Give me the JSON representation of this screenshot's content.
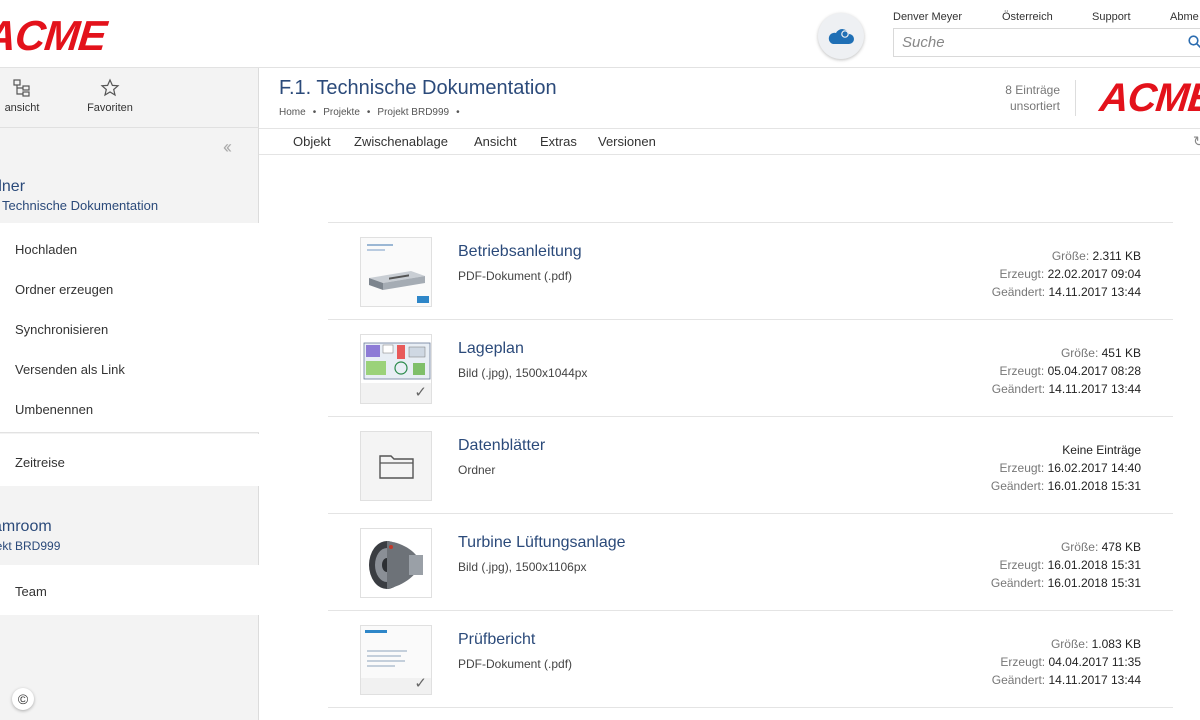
{
  "brand": {
    "logo": "ACME",
    "accent": "#e3121b",
    "link_color": "#2b4a7a"
  },
  "topbar": {
    "user": "Denver Meyer",
    "country": "Österreich",
    "support": "Support",
    "logout": "Abme",
    "search_placeholder": "Suche"
  },
  "sidebar": {
    "tabs": [
      {
        "label": "ansicht",
        "icon": "tree-view-icon"
      },
      {
        "label": "Favoriten",
        "icon": "star-icon"
      }
    ],
    "folder_section": {
      "title": "dner",
      "subtitle": "Technische Dokumentation"
    },
    "actions": [
      "Hochladen",
      "Ordner erzeugen",
      "Synchronisieren",
      "Versenden als Link",
      "Umbenennen"
    ],
    "timetravel": "Zeitreise",
    "teamroom_section": {
      "title": "amroom",
      "subtitle": "jekt BRD999"
    },
    "team": "Team",
    "copyright": "©"
  },
  "header": {
    "title": "F.1. Technische Dokumentation",
    "breadcrumb": [
      "Home",
      "Projekte",
      "Projekt BRD999"
    ],
    "breadcrumb_sep": "•",
    "entries_count": "8 Einträge",
    "entries_sort": "unsortiert",
    "logo": "ACME"
  },
  "menu": [
    "Objekt",
    "Zwischenablage",
    "Ansicht",
    "Extras",
    "Versionen"
  ],
  "files": [
    {
      "name": "Betriebsanleitung",
      "type": "PDF-Dokument (.pdf)",
      "meta": [
        {
          "k": "Größe:",
          "v": "2.311 KB"
        },
        {
          "k": "Erzeugt:",
          "v": "22.02.2017 09:04"
        },
        {
          "k": "Geändert:",
          "v": "14.11.2017 13:44"
        }
      ],
      "thumb": "pdf-server",
      "checked": false
    },
    {
      "name": "Lageplan",
      "type": "Bild (.jpg), 1500x1044px",
      "meta": [
        {
          "k": "Größe:",
          "v": "451 KB"
        },
        {
          "k": "Erzeugt:",
          "v": "05.04.2017 08:28"
        },
        {
          "k": "Geändert:",
          "v": "14.11.2017 13:44"
        }
      ],
      "thumb": "floorplan",
      "checked": true
    },
    {
      "name": "Datenblätter",
      "type": "Ordner",
      "meta": [
        {
          "k": "",
          "v": "Keine Einträge"
        },
        {
          "k": "Erzeugt:",
          "v": "16.02.2017 14:40"
        },
        {
          "k": "Geändert:",
          "v": "16.01.2018 15:31"
        }
      ],
      "thumb": "folder",
      "checked": false
    },
    {
      "name": "Turbine Lüftungsanlage",
      "type": "Bild (.jpg), 1500x1106px",
      "meta": [
        {
          "k": "Größe:",
          "v": "478 KB"
        },
        {
          "k": "Erzeugt:",
          "v": "16.01.2018 15:31"
        },
        {
          "k": "Geändert:",
          "v": "16.01.2018 15:31"
        }
      ],
      "thumb": "turbine",
      "checked": false
    },
    {
      "name": "Prüfbericht",
      "type": "PDF-Dokument (.pdf)",
      "meta": [
        {
          "k": "Größe:",
          "v": "1.083 KB"
        },
        {
          "k": "Erzeugt:",
          "v": "04.04.2017 11:35"
        },
        {
          "k": "Geändert:",
          "v": "14.11.2017 13:44"
        }
      ],
      "thumb": "pdf-report",
      "checked": true
    }
  ]
}
